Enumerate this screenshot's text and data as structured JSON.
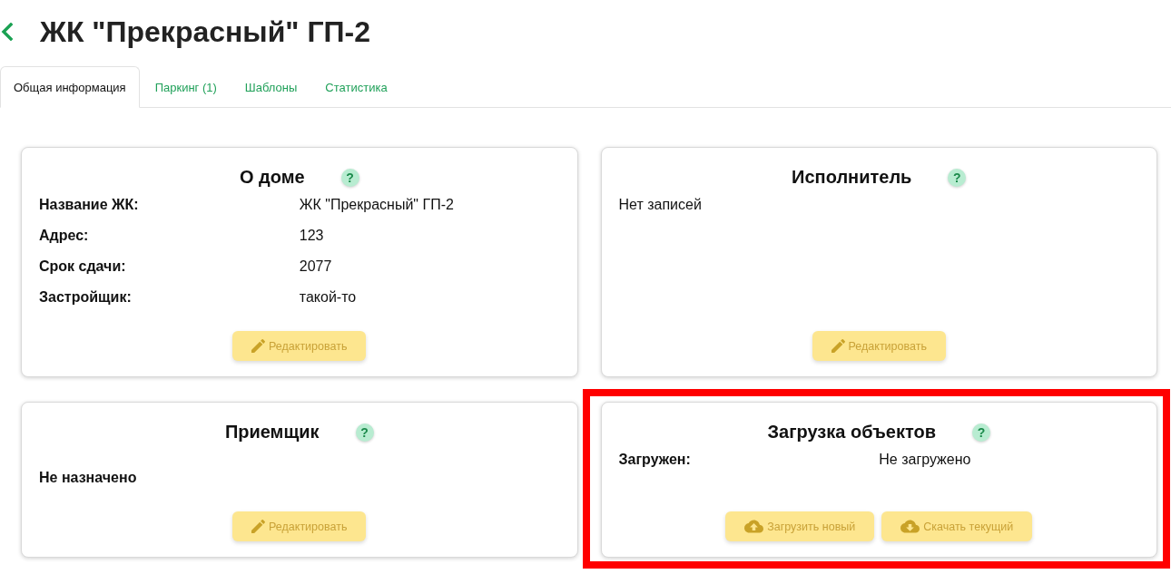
{
  "header": {
    "title": "ЖК \"Прекрасный\" ГП-2"
  },
  "tabs": [
    {
      "label": "Общая информация",
      "selected": true
    },
    {
      "label": "Паркинг (1)",
      "selected": false
    },
    {
      "label": "Шаблоны",
      "selected": false
    },
    {
      "label": "Статистика",
      "selected": false
    }
  ],
  "cards": [
    {
      "kind": "fields",
      "title": "О доме",
      "help": "?",
      "highlighted": false,
      "fields": [
        {
          "label": "Название ЖК:",
          "value": "ЖК \"Прекрасный\" ГП-2"
        },
        {
          "label": "Адрес:",
          "value": "123"
        },
        {
          "label": "Срок сдачи:",
          "value": "2077"
        },
        {
          "label": "Застройщик:",
          "value": "такой-то"
        }
      ],
      "buttons": [
        {
          "kind": "edit",
          "label": "Редактировать",
          "disabled": true
        }
      ]
    },
    {
      "kind": "empty",
      "title": "Исполнитель",
      "help": "?",
      "highlighted": false,
      "message": "Нет записей",
      "buttons": [
        {
          "kind": "edit",
          "label": "Редактировать",
          "disabled": true
        }
      ]
    },
    {
      "kind": "notice",
      "title": "Приемщик",
      "help": "?",
      "highlighted": false,
      "message": "Не назначено",
      "buttons": [
        {
          "kind": "edit",
          "label": "Редактировать",
          "disabled": true
        }
      ]
    },
    {
      "kind": "fields",
      "title": "Загрузка объектов",
      "help": "?",
      "highlighted": true,
      "fields": [
        {
          "label": "Загружен:",
          "value": "Не загружено"
        }
      ],
      "buttons": [
        {
          "kind": "upload",
          "label": "Загрузить новый",
          "disabled": true
        },
        {
          "kind": "download",
          "label": "Скачать текущий",
          "disabled": true
        }
      ]
    }
  ]
}
